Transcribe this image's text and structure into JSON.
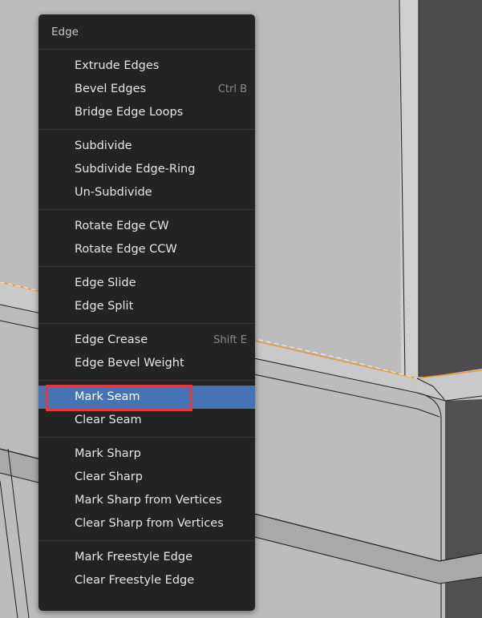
{
  "menu": {
    "title": "Edge",
    "groups": [
      {
        "items": [
          {
            "label": "Extrude Edges",
            "shortcut": ""
          },
          {
            "label": "Bevel Edges",
            "shortcut": "Ctrl B"
          },
          {
            "label": "Bridge Edge Loops",
            "shortcut": ""
          }
        ]
      },
      {
        "items": [
          {
            "label": "Subdivide",
            "shortcut": ""
          },
          {
            "label": "Subdivide Edge-Ring",
            "shortcut": ""
          },
          {
            "label": "Un-Subdivide",
            "shortcut": ""
          }
        ]
      },
      {
        "items": [
          {
            "label": "Rotate Edge CW",
            "shortcut": ""
          },
          {
            "label": "Rotate Edge CCW",
            "shortcut": ""
          }
        ]
      },
      {
        "items": [
          {
            "label": "Edge Slide",
            "shortcut": ""
          },
          {
            "label": "Edge Split",
            "shortcut": ""
          }
        ]
      },
      {
        "items": [
          {
            "label": "Edge Crease",
            "shortcut": "Shift E"
          },
          {
            "label": "Edge Bevel Weight",
            "shortcut": ""
          }
        ]
      },
      {
        "items": [
          {
            "label": "Mark Seam",
            "shortcut": "",
            "active": true,
            "highlighted": true
          },
          {
            "label": "Clear Seam",
            "shortcut": ""
          }
        ]
      },
      {
        "items": [
          {
            "label": "Mark Sharp",
            "shortcut": ""
          },
          {
            "label": "Clear Sharp",
            "shortcut": ""
          },
          {
            "label": "Mark Sharp from Vertices",
            "shortcut": ""
          },
          {
            "label": "Clear Sharp from Vertices",
            "shortcut": ""
          }
        ]
      },
      {
        "items": [
          {
            "label": "Mark Freestyle Edge",
            "shortcut": ""
          },
          {
            "label": "Clear Freestyle Edge",
            "shortcut": ""
          }
        ]
      }
    ]
  },
  "colors": {
    "menu_bg": "#232323",
    "active_bg": "#4772b3",
    "highlight_box": "#e03a3e",
    "selected_edge": "#e89a2c",
    "viewport_face": "#bdbdbd"
  }
}
